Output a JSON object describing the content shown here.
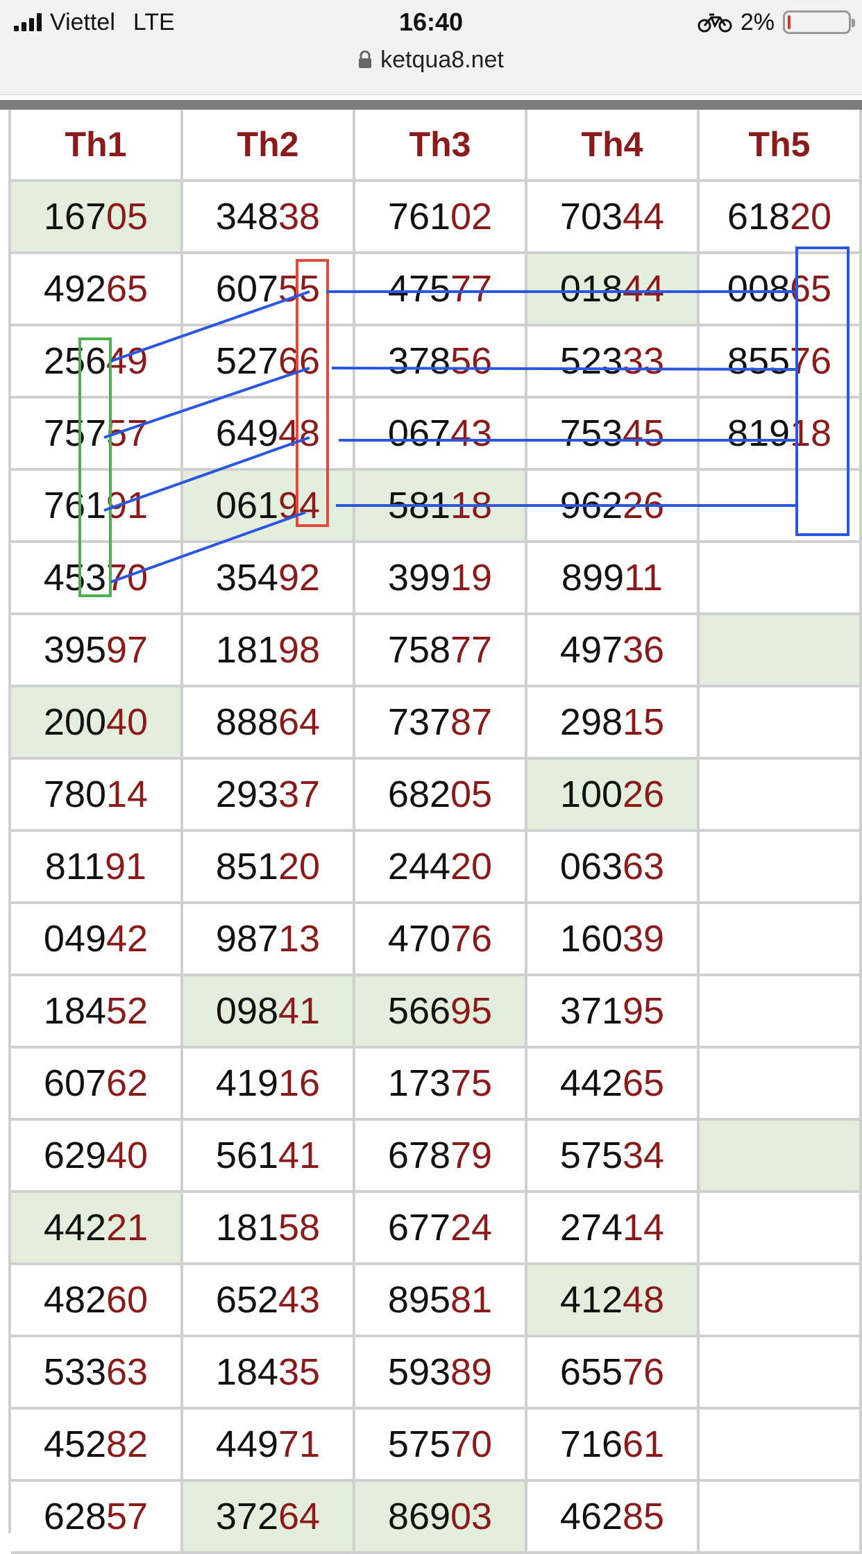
{
  "status": {
    "carrier": "Viettel",
    "network": "LTE",
    "time": "16:40",
    "battery": "2%",
    "battery_level": 0.02
  },
  "browser": {
    "url": "ketqua8.net"
  },
  "table": {
    "headers": [
      "Th1",
      "Th2",
      "Th3",
      "Th4",
      "Th5"
    ],
    "rows": [
      [
        "16705",
        "34838",
        "76102",
        "70344",
        "61820"
      ],
      [
        "49265",
        "60755",
        "47577",
        "01844",
        "00865"
      ],
      [
        "25649",
        "52766",
        "37856",
        "52333",
        "85576"
      ],
      [
        "75757",
        "64948",
        "06743",
        "75345",
        "81918"
      ],
      [
        "76191",
        "06194",
        "58118",
        "96226",
        ""
      ],
      [
        "45370",
        "35492",
        "39919",
        "89911",
        ""
      ],
      [
        "39597",
        "18198",
        "75877",
        "49736",
        ""
      ],
      [
        "20040",
        "88864",
        "73787",
        "29815",
        ""
      ],
      [
        "78014",
        "29337",
        "68205",
        "10026",
        ""
      ],
      [
        "81191",
        "85120",
        "24420",
        "06363",
        ""
      ],
      [
        "04942",
        "98713",
        "47076",
        "16039",
        ""
      ],
      [
        "18452",
        "09841",
        "56695",
        "37195",
        ""
      ],
      [
        "60762",
        "41916",
        "17375",
        "44265",
        ""
      ],
      [
        "62940",
        "56141",
        "67879",
        "57534",
        ""
      ],
      [
        "44221",
        "18158",
        "67724",
        "27414",
        ""
      ],
      [
        "48260",
        "65243",
        "89581",
        "41248",
        ""
      ],
      [
        "53363",
        "18435",
        "59389",
        "65576",
        ""
      ],
      [
        "45282",
        "44971",
        "57570",
        "71661",
        ""
      ],
      [
        "62857",
        "37264",
        "86903",
        "46285",
        ""
      ]
    ],
    "highlighted": [
      [
        0,
        0
      ],
      [
        1,
        3
      ],
      [
        4,
        1
      ],
      [
        4,
        2
      ],
      [
        6,
        4
      ],
      [
        7,
        0
      ],
      [
        8,
        3
      ],
      [
        11,
        1
      ],
      [
        11,
        2
      ],
      [
        13,
        4
      ],
      [
        14,
        0
      ],
      [
        15,
        3
      ],
      [
        18,
        1
      ],
      [
        18,
        2
      ]
    ]
  },
  "colors": {
    "header_text": "#8b1a1a",
    "last_two_digits": "#8b1a1a",
    "highlight_bg": "#e3efdc",
    "annotation_blue": "#2b57e0",
    "annotation_red": "#e04a3a",
    "annotation_green": "#4caf50"
  },
  "icons": {
    "signal": "signal-bars-icon",
    "bike": "bicycle-icon",
    "lock": "lock-icon",
    "battery": "battery-icon"
  }
}
